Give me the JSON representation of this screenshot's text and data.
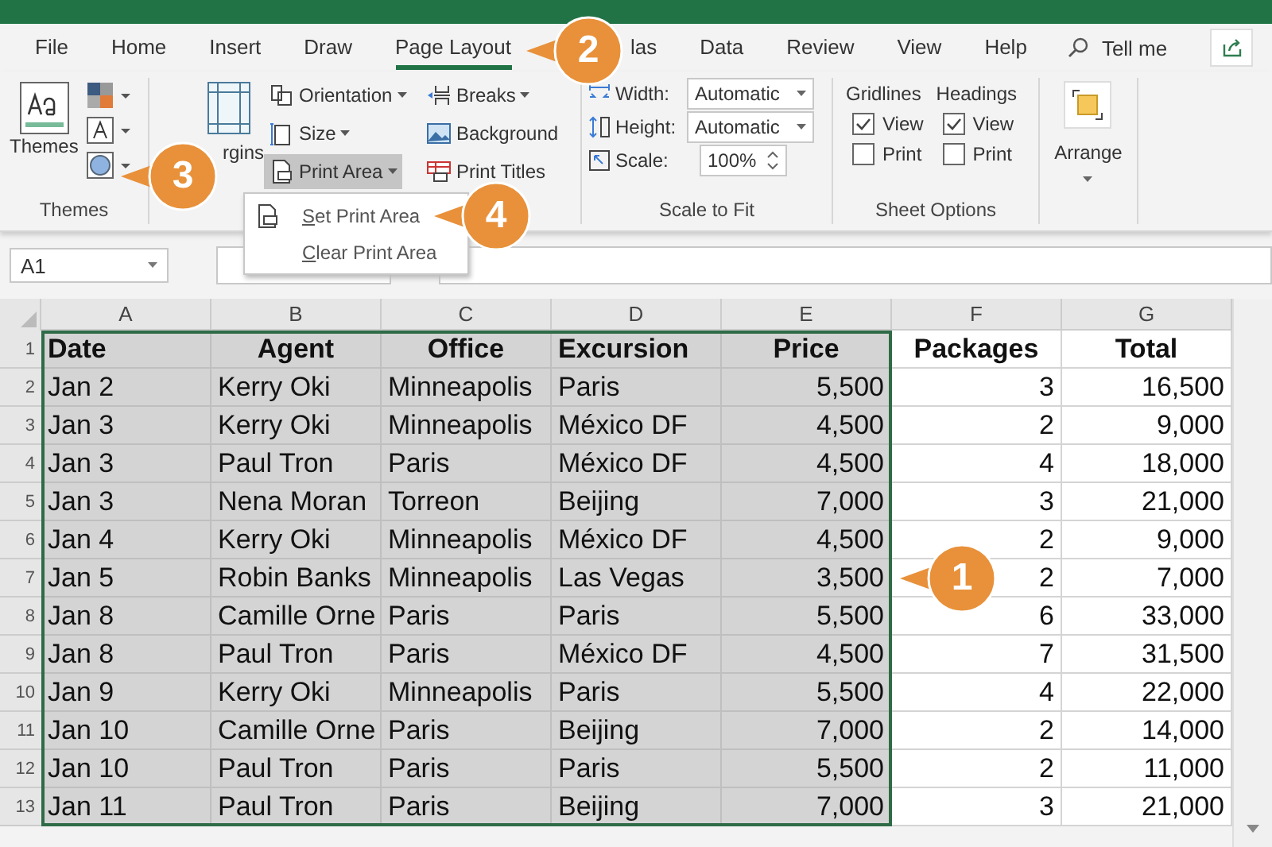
{
  "tabs": [
    {
      "label": "File",
      "selected": false
    },
    {
      "label": "Home",
      "selected": false
    },
    {
      "label": "Insert",
      "selected": false
    },
    {
      "label": "Draw",
      "selected": false
    },
    {
      "label": "Page Layout",
      "selected": true
    },
    {
      "label": "las",
      "selected": false
    },
    {
      "label": "Data",
      "selected": false
    },
    {
      "label": "Review",
      "selected": false
    },
    {
      "label": "View",
      "selected": false
    },
    {
      "label": "Help",
      "selected": false
    }
  ],
  "tell_me": "Tell me",
  "themes": {
    "button": "Themes",
    "group_label": "Themes"
  },
  "page_setup": {
    "margins": "rgins",
    "items": [
      {
        "label": "Orientation",
        "kind": "orientation",
        "dropdown": true,
        "selected": false
      },
      {
        "label": "Breaks",
        "kind": "breaks",
        "dropdown": true,
        "selected": false
      },
      {
        "label": "Size",
        "kind": "size",
        "dropdown": true,
        "selected": false
      },
      {
        "label": "Background",
        "kind": "background",
        "dropdown": false,
        "selected": false
      },
      {
        "label": "Print Area",
        "kind": "printarea",
        "dropdown": true,
        "selected": true
      },
      {
        "label": "Print Titles",
        "kind": "titles",
        "dropdown": false,
        "selected": false
      }
    ]
  },
  "print_area_menu": [
    {
      "label": "Set Print Area"
    },
    {
      "label": "Clear Print Area"
    }
  ],
  "scale_to_fit": {
    "group_label": "Scale to Fit",
    "fields": [
      {
        "label": "Width:",
        "value": "Automatic",
        "kind": "select"
      },
      {
        "label": "Height:",
        "value": "Automatic",
        "kind": "select"
      },
      {
        "label": "Scale:",
        "value": "100%",
        "kind": "spin"
      }
    ]
  },
  "sheet_options": {
    "group_label": "Sheet Options",
    "groups": [
      {
        "title": "Gridlines",
        "options": [
          {
            "label": "View",
            "checked": true
          },
          {
            "label": "Print",
            "checked": false
          }
        ]
      },
      {
        "title": "Headings",
        "options": [
          {
            "label": "View",
            "checked": true
          },
          {
            "label": "Print",
            "checked": false
          }
        ]
      }
    ]
  },
  "arrange": {
    "label": "Arrange"
  },
  "name_box": "A1",
  "columns": [
    {
      "letter": "A",
      "print_area": true
    },
    {
      "letter": "B",
      "print_area": true
    },
    {
      "letter": "C",
      "print_area": true
    },
    {
      "letter": "D",
      "print_area": true
    },
    {
      "letter": "E",
      "print_area": true
    },
    {
      "letter": "F",
      "print_area": false
    },
    {
      "letter": "G",
      "print_area": false
    }
  ],
  "rows": [
    {
      "number": "1",
      "kind": "header",
      "cells": [
        "Date",
        "Agent",
        "Office",
        "Excursion",
        "Price",
        "Packages",
        "Total"
      ]
    },
    {
      "number": "2",
      "kind": "data",
      "cells": [
        "Jan 2",
        "Kerry Oki",
        "Minneapolis",
        "Paris",
        "5,500",
        "3",
        "16,500"
      ]
    },
    {
      "number": "3",
      "kind": "data",
      "cells": [
        "Jan 3",
        "Kerry Oki",
        "Minneapolis",
        "México DF",
        "4,500",
        "2",
        "9,000"
      ]
    },
    {
      "number": "4",
      "kind": "data",
      "cells": [
        "Jan 3",
        "Paul Tron",
        "Paris",
        "México DF",
        "4,500",
        "4",
        "18,000"
      ]
    },
    {
      "number": "5",
      "kind": "data",
      "cells": [
        "Jan 3",
        "Nena Moran",
        "Torreon",
        "Beijing",
        "7,000",
        "3",
        "21,000"
      ]
    },
    {
      "number": "6",
      "kind": "data",
      "cells": [
        "Jan 4",
        "Kerry Oki",
        "Minneapolis",
        "México DF",
        "4,500",
        "2",
        "9,000"
      ]
    },
    {
      "number": "7",
      "kind": "data",
      "cells": [
        "Jan 5",
        "Robin Banks",
        "Minneapolis",
        "Las Vegas",
        "3,500",
        "2",
        "7,000"
      ]
    },
    {
      "number": "8",
      "kind": "data",
      "cells": [
        "Jan 8",
        "Camille Orne",
        "Paris",
        "Paris",
        "5,500",
        "6",
        "33,000"
      ]
    },
    {
      "number": "9",
      "kind": "data",
      "cells": [
        "Jan 8",
        "Paul Tron",
        "Paris",
        "México DF",
        "4,500",
        "7",
        "31,500"
      ]
    },
    {
      "number": "10",
      "kind": "data",
      "cells": [
        "Jan 9",
        "Kerry Oki",
        "Minneapolis",
        "Paris",
        "5,500",
        "4",
        "22,000"
      ]
    },
    {
      "number": "11",
      "kind": "data",
      "cells": [
        "Jan 10",
        "Camille Orne",
        "Paris",
        "Beijing",
        "7,000",
        "2",
        "14,000"
      ]
    },
    {
      "number": "12",
      "kind": "data",
      "cells": [
        "Jan 10",
        "Paul Tron",
        "Paris",
        "Paris",
        "5,500",
        "2",
        "11,000"
      ]
    },
    {
      "number": "13",
      "kind": "data",
      "cells": [
        "Jan 11",
        "Paul Tron",
        "Paris",
        "Beijing",
        "7,000",
        "3",
        "21,000"
      ]
    }
  ],
  "callouts": [
    {
      "number": "1"
    },
    {
      "number": "2"
    },
    {
      "number": "3"
    },
    {
      "number": "4"
    }
  ]
}
